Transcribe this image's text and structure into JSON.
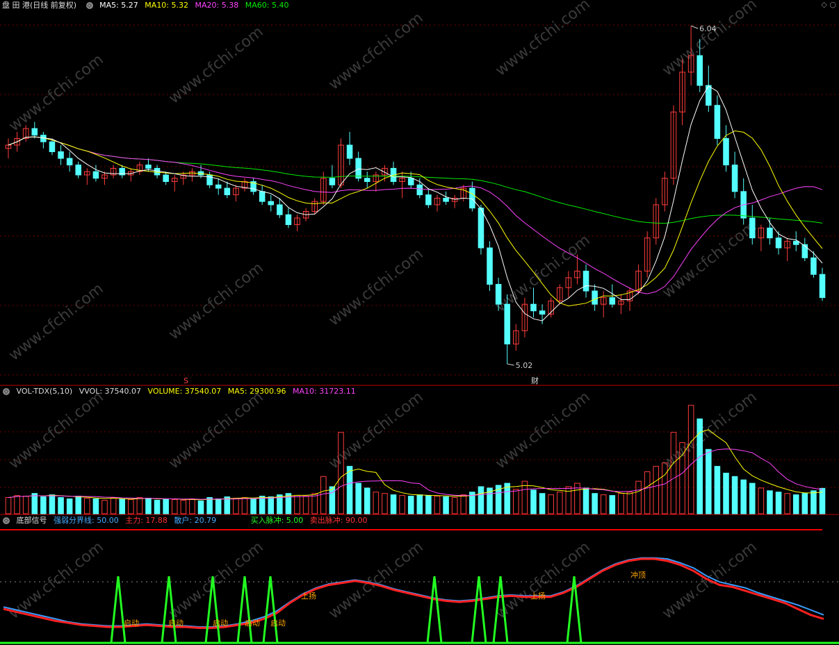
{
  "colors": {
    "up": "#ff3c3c",
    "down": "#54ffff",
    "ma5": "#ffffff",
    "ma10": "#ffff00",
    "ma20": "#ff44ff",
    "ma60": "#00ee00",
    "grid": "#7a0000",
    "sep": "#c00000",
    "strong": "#3c9dff",
    "main": "#ff2020",
    "green": "#22ff22",
    "label": "#ffa500"
  },
  "price": {
    "title": "盘 田 港(日线 前复权)",
    "ma5_label": "MA5: 5.27",
    "ma10_label": "MA10: 5.32",
    "ma20_label": "MA20: 5.38",
    "ma60_label": "MA60: 5.40",
    "high_label": "6.04",
    "low_label": "5.02",
    "marker_s": "S",
    "marker_cai": "财",
    "ylim": [
      4.97,
      6.08
    ]
  },
  "volume": {
    "title": "VOL-TDX(5,10)",
    "vvol": "VVOL: 37540.07",
    "volume_label": "VOLUME: 37540.07",
    "ma5_label": "MA5: 29300.96",
    "ma10_label": "MA10: 31723.11",
    "ylim": [
      0,
      170000
    ]
  },
  "indicator": {
    "title": "底部信号",
    "strong_label": "强弱分界线: 50.00",
    "main_label": "主力: 17.88",
    "retail_label": "散户: 20.79",
    "buy_label": "买入脉冲: 5.00",
    "sell_label": "卖出脉冲: 90.00",
    "start": "启动",
    "rise": "上扬",
    "top": "冲顶",
    "ylim": [
      0,
      100
    ]
  },
  "watermark": "www.cfchi.com",
  "chart_data": {
    "type": "candlestick",
    "candles": [
      [
        5.67,
        5.7,
        5.64,
        5.68,
        24000
      ],
      [
        5.68,
        5.72,
        5.66,
        5.7,
        27000
      ],
      [
        5.7,
        5.74,
        5.69,
        5.73,
        26000
      ],
      [
        5.73,
        5.75,
        5.7,
        5.71,
        30000
      ],
      [
        5.71,
        5.72,
        5.67,
        5.69,
        25000
      ],
      [
        5.69,
        5.7,
        5.65,
        5.66,
        28000
      ],
      [
        5.66,
        5.68,
        5.62,
        5.64,
        24000
      ],
      [
        5.64,
        5.66,
        5.6,
        5.62,
        22000
      ],
      [
        5.62,
        5.63,
        5.58,
        5.59,
        26000
      ],
      [
        5.59,
        5.61,
        5.56,
        5.6,
        23000
      ],
      [
        5.6,
        5.62,
        5.57,
        5.58,
        22000
      ],
      [
        5.58,
        5.6,
        5.56,
        5.59,
        20000
      ],
      [
        5.59,
        5.62,
        5.58,
        5.61,
        24000
      ],
      [
        5.61,
        5.62,
        5.58,
        5.59,
        22000
      ],
      [
        5.59,
        5.61,
        5.57,
        5.6,
        21000
      ],
      [
        5.6,
        5.63,
        5.59,
        5.62,
        24000
      ],
      [
        5.62,
        5.64,
        5.6,
        5.61,
        23000
      ],
      [
        5.61,
        5.62,
        5.58,
        5.59,
        20000
      ],
      [
        5.59,
        5.6,
        5.56,
        5.57,
        22000
      ],
      [
        5.57,
        5.59,
        5.54,
        5.58,
        21000
      ],
      [
        5.58,
        5.6,
        5.56,
        5.59,
        20000
      ],
      [
        5.59,
        5.61,
        5.57,
        5.6,
        22000
      ],
      [
        5.6,
        5.62,
        5.58,
        5.59,
        19000
      ],
      [
        5.59,
        5.6,
        5.55,
        5.56,
        24000
      ],
      [
        5.56,
        5.58,
        5.53,
        5.55,
        22000
      ],
      [
        5.55,
        5.57,
        5.52,
        5.53,
        25000
      ],
      [
        5.53,
        5.56,
        5.51,
        5.55,
        23000
      ],
      [
        5.55,
        5.58,
        5.54,
        5.57,
        24000
      ],
      [
        5.57,
        5.58,
        5.53,
        5.54,
        22000
      ],
      [
        5.54,
        5.56,
        5.5,
        5.51,
        26000
      ],
      [
        5.51,
        5.53,
        5.48,
        5.5,
        25000
      ],
      [
        5.5,
        5.52,
        5.46,
        5.47,
        28000
      ],
      [
        5.47,
        5.49,
        5.43,
        5.44,
        30000
      ],
      [
        5.44,
        5.47,
        5.42,
        5.46,
        27000
      ],
      [
        5.46,
        5.49,
        5.45,
        5.48,
        26000
      ],
      [
        5.48,
        5.52,
        5.47,
        5.51,
        30000
      ],
      [
        5.51,
        5.6,
        5.5,
        5.58,
        55000
      ],
      [
        5.58,
        5.62,
        5.55,
        5.56,
        40000
      ],
      [
        5.56,
        5.7,
        5.55,
        5.68,
        120000
      ],
      [
        5.68,
        5.72,
        5.62,
        5.64,
        70000
      ],
      [
        5.64,
        5.66,
        5.57,
        5.58,
        45000
      ],
      [
        5.58,
        5.6,
        5.55,
        5.57,
        38000
      ],
      [
        5.57,
        5.6,
        5.54,
        5.59,
        32000
      ],
      [
        5.59,
        5.62,
        5.57,
        5.61,
        30000
      ],
      [
        5.61,
        5.63,
        5.56,
        5.57,
        28000
      ],
      [
        5.57,
        5.6,
        5.52,
        5.58,
        27000
      ],
      [
        5.58,
        5.6,
        5.55,
        5.56,
        26000
      ],
      [
        5.56,
        5.58,
        5.52,
        5.53,
        28000
      ],
      [
        5.53,
        5.55,
        5.49,
        5.5,
        27000
      ],
      [
        5.5,
        5.53,
        5.48,
        5.52,
        26000
      ],
      [
        5.52,
        5.54,
        5.5,
        5.51,
        25000
      ],
      [
        5.51,
        5.53,
        5.49,
        5.52,
        24000
      ],
      [
        5.52,
        5.56,
        5.51,
        5.55,
        28000
      ],
      [
        5.55,
        5.57,
        5.48,
        5.49,
        32000
      ],
      [
        5.49,
        5.5,
        5.35,
        5.37,
        40000
      ],
      [
        5.37,
        5.39,
        5.24,
        5.26,
        38000
      ],
      [
        5.26,
        5.28,
        5.18,
        5.2,
        42000
      ],
      [
        5.2,
        5.23,
        5.02,
        5.08,
        45000
      ],
      [
        5.08,
        5.14,
        5.06,
        5.12,
        36000
      ],
      [
        5.12,
        5.22,
        5.1,
        5.2,
        48000
      ],
      [
        5.2,
        5.25,
        5.16,
        5.18,
        35000
      ],
      [
        5.18,
        5.2,
        5.14,
        5.17,
        30000
      ],
      [
        5.17,
        5.22,
        5.16,
        5.21,
        28000
      ],
      [
        5.21,
        5.26,
        5.2,
        5.25,
        32000
      ],
      [
        5.25,
        5.3,
        5.22,
        5.28,
        40000
      ],
      [
        5.28,
        5.35,
        5.26,
        5.3,
        45000
      ],
      [
        5.3,
        5.32,
        5.22,
        5.24,
        38000
      ],
      [
        5.24,
        5.26,
        5.18,
        5.2,
        30000
      ],
      [
        5.2,
        5.24,
        5.16,
        5.22,
        28000
      ],
      [
        5.22,
        5.26,
        5.19,
        5.2,
        27000
      ],
      [
        5.2,
        5.23,
        5.17,
        5.21,
        30000
      ],
      [
        5.21,
        5.25,
        5.18,
        5.24,
        32000
      ],
      [
        5.24,
        5.32,
        5.23,
        5.3,
        48000
      ],
      [
        5.3,
        5.42,
        5.28,
        5.4,
        62000
      ],
      [
        5.4,
        5.52,
        5.38,
        5.5,
        70000
      ],
      [
        5.5,
        5.6,
        5.48,
        5.58,
        75000
      ],
      [
        5.58,
        5.8,
        5.56,
        5.78,
        120000
      ],
      [
        5.78,
        5.94,
        5.74,
        5.9,
        105000
      ],
      [
        5.9,
        6.04,
        5.86,
        5.95,
        160000
      ],
      [
        5.95,
        6.0,
        5.84,
        5.86,
        140000
      ],
      [
        5.86,
        5.92,
        5.78,
        5.8,
        95000
      ],
      [
        5.8,
        5.83,
        5.68,
        5.7,
        70000
      ],
      [
        5.7,
        5.74,
        5.6,
        5.62,
        60000
      ],
      [
        5.62,
        5.66,
        5.52,
        5.54,
        55000
      ],
      [
        5.54,
        5.58,
        5.44,
        5.46,
        50000
      ],
      [
        5.46,
        5.5,
        5.38,
        5.4,
        45000
      ],
      [
        5.4,
        5.44,
        5.36,
        5.43,
        38000
      ],
      [
        5.43,
        5.46,
        5.38,
        5.4,
        34000
      ],
      [
        5.4,
        5.42,
        5.35,
        5.37,
        32000
      ],
      [
        5.37,
        5.4,
        5.33,
        5.39,
        30000
      ],
      [
        5.39,
        5.42,
        5.36,
        5.38,
        28000
      ],
      [
        5.38,
        5.4,
        5.33,
        5.34,
        30000
      ],
      [
        5.34,
        5.36,
        5.28,
        5.29,
        34000
      ],
      [
        5.29,
        5.31,
        5.21,
        5.22,
        37540
      ]
    ],
    "indicator": {
      "main": [
        34,
        31,
        28,
        25,
        22,
        20,
        18,
        17,
        16,
        16,
        17,
        18,
        17,
        16,
        16,
        15,
        15,
        16,
        18,
        20,
        24,
        30,
        40,
        48,
        54,
        58,
        60,
        62,
        60,
        57,
        53,
        50,
        47,
        44,
        42,
        41,
        42,
        44,
        46,
        47,
        46,
        46,
        46,
        50,
        56,
        64,
        72,
        78,
        82,
        84,
        84,
        82,
        78,
        72,
        64,
        58,
        56,
        52,
        48,
        44,
        40,
        34,
        28,
        24
      ],
      "retail": [
        36,
        33,
        30,
        27,
        24,
        21,
        19,
        18,
        17,
        17,
        18,
        19,
        18,
        17,
        17,
        16,
        16,
        17,
        19,
        22,
        26,
        32,
        41,
        49,
        55,
        59,
        61,
        63,
        61,
        58,
        54,
        51,
        48,
        45,
        43,
        42,
        43,
        45,
        47,
        48,
        47,
        47,
        47,
        51,
        57,
        65,
        73,
        79,
        83,
        85,
        85,
        84,
        80,
        75,
        67,
        61,
        58,
        55,
        50,
        46,
        42,
        38,
        33,
        28
      ],
      "pulses": [
        170,
        243,
        306,
        352,
        389,
        625,
        689,
        720,
        826
      ]
    }
  }
}
